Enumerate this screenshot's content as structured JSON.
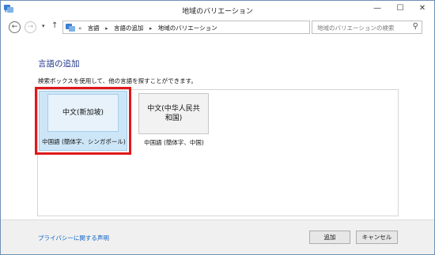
{
  "window": {
    "title": "地域のバリエーション",
    "min_glyph": "—",
    "max_glyph": "☐",
    "close_glyph": "✕"
  },
  "nav": {
    "back_glyph": "←",
    "forward_glyph": "→",
    "dropdown_glyph": "▾",
    "up_glyph": "↑",
    "prefix_glyph": "«",
    "breadcrumbs": [
      "言語",
      "言語の追加",
      "地域のバリエーション"
    ],
    "crumb_separator": "▸",
    "refresh_glyph": "↻",
    "search_placeholder": "地域のバリエーションの検索",
    "search_glyph": "⚲"
  },
  "main": {
    "title": "言語の追加",
    "description": "検索ボックスを使用して、他の言語を探すことができます。",
    "languages": [
      {
        "tile_label": "中文(新加坡)",
        "caption": "中国語 (簡体字、シンガポール)",
        "selected": true
      },
      {
        "tile_label": "中文(中华人民共和国)",
        "tile_line1": "中文(中华人民共",
        "tile_line2": "和国)",
        "caption": "中国語 (簡体字、中国)",
        "selected": false
      }
    ]
  },
  "footer": {
    "privacy_link": "プライバシーに関する声明",
    "add_button": "追加",
    "cancel_button": "キャンセル"
  },
  "colors": {
    "title_blue": "#1e3287",
    "link_blue": "#0a62c4",
    "selection_red": "#e0181b",
    "tile_selected_bg": "#cde6f7"
  },
  "icons": {
    "app": "language-globe-icon",
    "address": "language-globe-icon"
  }
}
